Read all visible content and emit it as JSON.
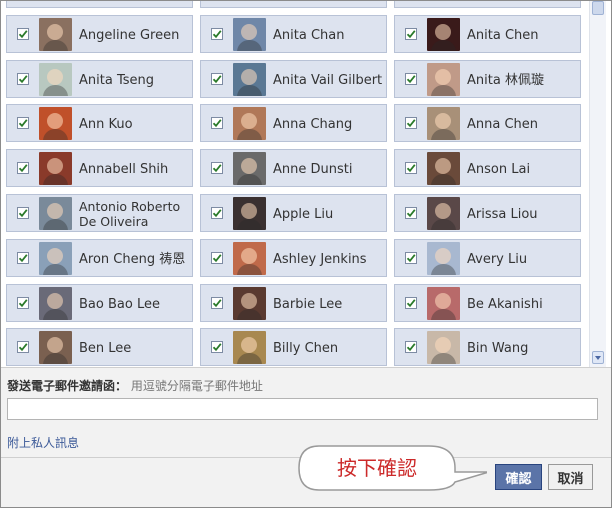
{
  "friends": [
    {
      "name": "Angeline Green",
      "checked": true,
      "color": "#8a7060"
    },
    {
      "name": "Anita Chan",
      "checked": true,
      "color": "#6f87a8"
    },
    {
      "name": "Anita Chen",
      "checked": true,
      "color": "#3a1a1a"
    },
    {
      "name": "Anita Tseng",
      "checked": true,
      "color": "#b8c8c0"
    },
    {
      "name": "Anita Vail Gilbert",
      "checked": true,
      "color": "#5a7894"
    },
    {
      "name": "Anita 林佩璇",
      "checked": true,
      "color": "#c09a88"
    },
    {
      "name": "Ann Kuo",
      "checked": true,
      "color": "#c0502a"
    },
    {
      "name": "Anna Chang",
      "checked": true,
      "color": "#b07858"
    },
    {
      "name": "Anna Chen",
      "checked": true,
      "color": "#a89078"
    },
    {
      "name": "Annabell Shih",
      "checked": true,
      "color": "#8a3a2a"
    },
    {
      "name": "Anne Dunsti",
      "checked": true,
      "color": "#6a6a6a"
    },
    {
      "name": "Anson Lai",
      "checked": true,
      "color": "#6a4a3a"
    },
    {
      "name": "Antonio Roberto De Oliveira",
      "checked": true,
      "color": "#7a8a9a"
    },
    {
      "name": "Apple Liu",
      "checked": true,
      "color": "#3a3030"
    },
    {
      "name": "Arissa Liou",
      "checked": true,
      "color": "#5a4848"
    },
    {
      "name": "Aron Cheng 祷恩",
      "checked": true,
      "color": "#8aa0b8"
    },
    {
      "name": "Ashley Jenkins",
      "checked": true,
      "color": "#c06a4a"
    },
    {
      "name": "Avery Liu",
      "checked": true,
      "color": "#a8b8d0"
    },
    {
      "name": "Bao Bao Lee",
      "checked": true,
      "color": "#6a6a78"
    },
    {
      "name": "Barbie Lee",
      "checked": true,
      "color": "#5a3a30"
    },
    {
      "name": "Be Akanishi",
      "checked": true,
      "color": "#b86a6a"
    },
    {
      "name": "Ben Lee",
      "checked": true,
      "color": "#7a6050"
    },
    {
      "name": "Billy Chen",
      "checked": true,
      "color": "#a88850"
    },
    {
      "name": "Bin Wang",
      "checked": true,
      "color": "#c8b8a8"
    }
  ],
  "email_invite": {
    "label": "發送電子郵件邀請函：",
    "hint": "用逗號分隔電子郵件地址",
    "value": ""
  },
  "attach_message_link": "附上私人訊息",
  "callout_text": "按下確認",
  "buttons": {
    "confirm": "確認",
    "cancel": "取消"
  },
  "colors": {
    "cell_bg": "#dde3ef",
    "confirm_bg": "#5b74a8",
    "callout_text": "#cc2a2a",
    "link": "#3b5998"
  }
}
